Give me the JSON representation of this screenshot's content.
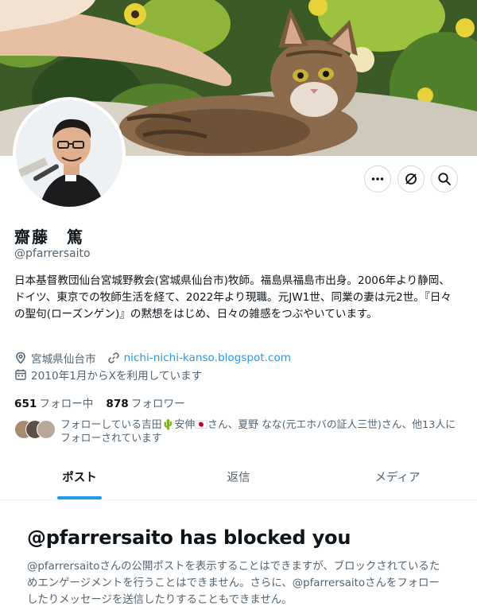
{
  "profile": {
    "name": "齋藤　篤",
    "handle": "@pfarrersaito",
    "bio": "日本基督教団仙台宮城野教会(宮城県仙台市)牧師。福島県福島市出身。2006年より静岡、ドイツ、東京での牧師生活を経て、2022年より現職。元JW1世、同業の妻は元2世。『日々の聖句(ローズンゲン)』の黙想をはじめ、日々の雑感をつぶやいています。",
    "location": "宮城県仙台市",
    "website": "nichi-nichi-kanso.blogspot.com",
    "joined": "2010年1月からXを利用しています",
    "following_count": "651",
    "following_label": "フォロー中",
    "followers_count": "878",
    "followers_label": "フォロワー",
    "followed_by_text": "フォローしている吉田🌵安伸🇯🇵さん、夏野 なな(元エホバの証人三世)さん、他13人にフォローされています"
  },
  "icons": {
    "more": "more-icon",
    "grok": "grok-icon",
    "search": "search-icon",
    "location": "location-pin-icon",
    "link": "link-icon",
    "calendar": "calendar-icon"
  },
  "tabs": [
    {
      "label": "ポスト",
      "active": true
    },
    {
      "label": "返信",
      "active": false
    },
    {
      "label": "メディア",
      "active": false
    }
  ],
  "blocked": {
    "title": "@pfarrersaito has blocked you",
    "body": "@pfarrersaitoさんの公開ポストを表示することはできますが、ブロックされているためエンゲージメントを行うことはできません。さらに、@pfarrersaitoさんをフォローしたりメッセージを送信したりすることもできません。"
  },
  "colors": {
    "accent": "#1d9bf0",
    "text": "#0f1419",
    "muted": "#536471",
    "border": "#cfd9de"
  }
}
